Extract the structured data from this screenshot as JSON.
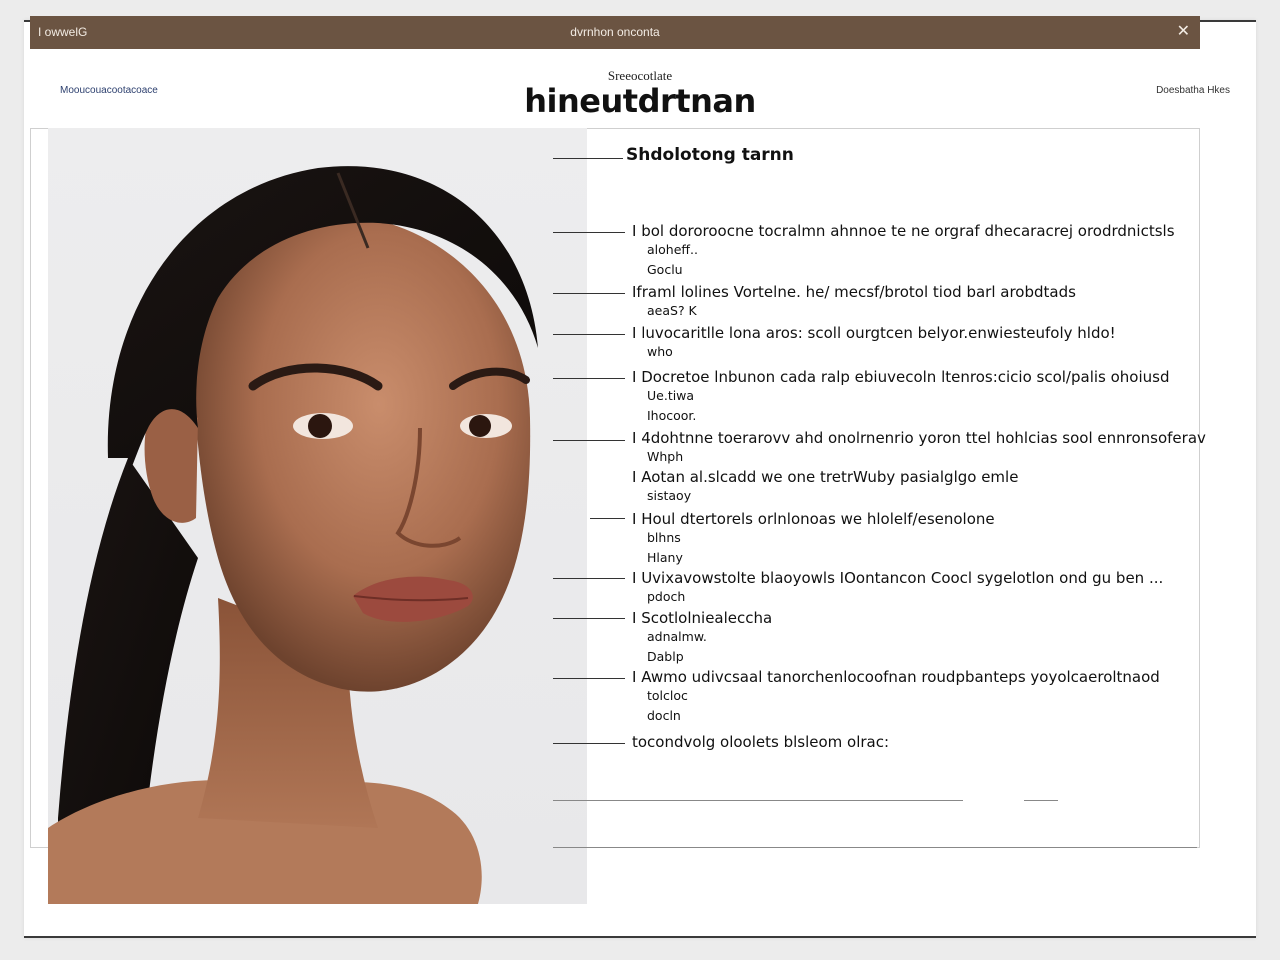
{
  "window": {
    "left_label": "I owwelG",
    "title": "dvrnhon onconta",
    "close_glyph": "✕"
  },
  "header": {
    "left": "Mooucouacootacoace",
    "kicker": "Sreeocotlate",
    "title": "hineutdrtnan",
    "right": "Doesbatha Hkes"
  },
  "section_title": "Shdolotong tarnn",
  "items": [
    {
      "main": "I bol dororoocne tocralmn ahnnoe te ne orgraf dhecaracrej orodrdnictsls",
      "subs": [
        "aloheff..",
        "Goclu"
      ]
    },
    {
      "main": "Iframl lolines Vortelne. he/ mecsf/brotol tiod barl arobdtads",
      "subs": [
        "aeaS? K"
      ]
    },
    {
      "main": "I luvocaritlle lona aros: scoll ourgtcen belyor.enwiesteufoly hldo!",
      "subs": [
        "who"
      ]
    },
    {
      "main": "I Docretoe lnbunon cada ralp ebiuvecoln ltenros:cicio scol/palis ohoiusd",
      "subs": [
        "Ue.tiwa",
        "Ihocoor."
      ]
    },
    {
      "main": "I 4dohtnne toerarovv ahd onolrnenrio yoron ttel hohlcias sool ennronsoferav",
      "subs": [
        "Whph"
      ]
    },
    {
      "main": "I Aotan al.slcadd we one tretrWuby pasialglgo emle",
      "subs": [
        "sistaoy"
      ]
    },
    {
      "main": "I Houl dtertorels orlnlonoas we hlolelf/esenolone",
      "subs": [
        "blhns",
        "Hlany"
      ]
    },
    {
      "main": "I Uvixavowstolte blaoyowls IOontancon Coocl sygelotlon ond gu ben ...",
      "subs": [
        "pdoch"
      ]
    },
    {
      "main": "I Scotlolniealeccha",
      "subs": [
        "adnalmw.",
        "Dablp"
      ]
    },
    {
      "main": "I Awmo udivcsaal tanorchenlocoofnan roudpbanteps yoyolcaeroltnaod",
      "subs": [
        "tolcloc",
        "docln"
      ]
    },
    {
      "main": "tocondvolg oloolets blsleom olrac:",
      "subs": []
    }
  ],
  "colors": {
    "titlebar": "#6b5442",
    "titlebar_text": "#f3ece4",
    "header_left_text": "#2c3f6e",
    "photo_background": "#ececee"
  }
}
